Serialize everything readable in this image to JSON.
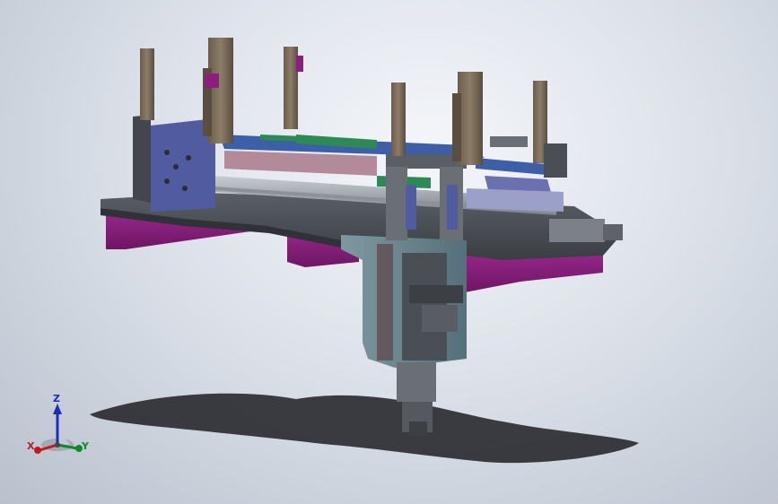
{
  "viewport": {
    "background_top": "#f4f6fa",
    "background_bottom": "#b9c1cd"
  },
  "triad": {
    "z_label": "Z",
    "x_label": "X",
    "y_label": "Y",
    "z_color": "#1a2dbd",
    "x_color": "#c01a1a",
    "y_color": "#0e8a2a"
  },
  "model": {
    "frame_color": "#4a4f55",
    "plate_color": "#3e4247",
    "block_color": "#8a1f7d",
    "post_color": "#7a6b58",
    "accent_blue": "#3d5fa8",
    "accent_green": "#2e8a55"
  }
}
